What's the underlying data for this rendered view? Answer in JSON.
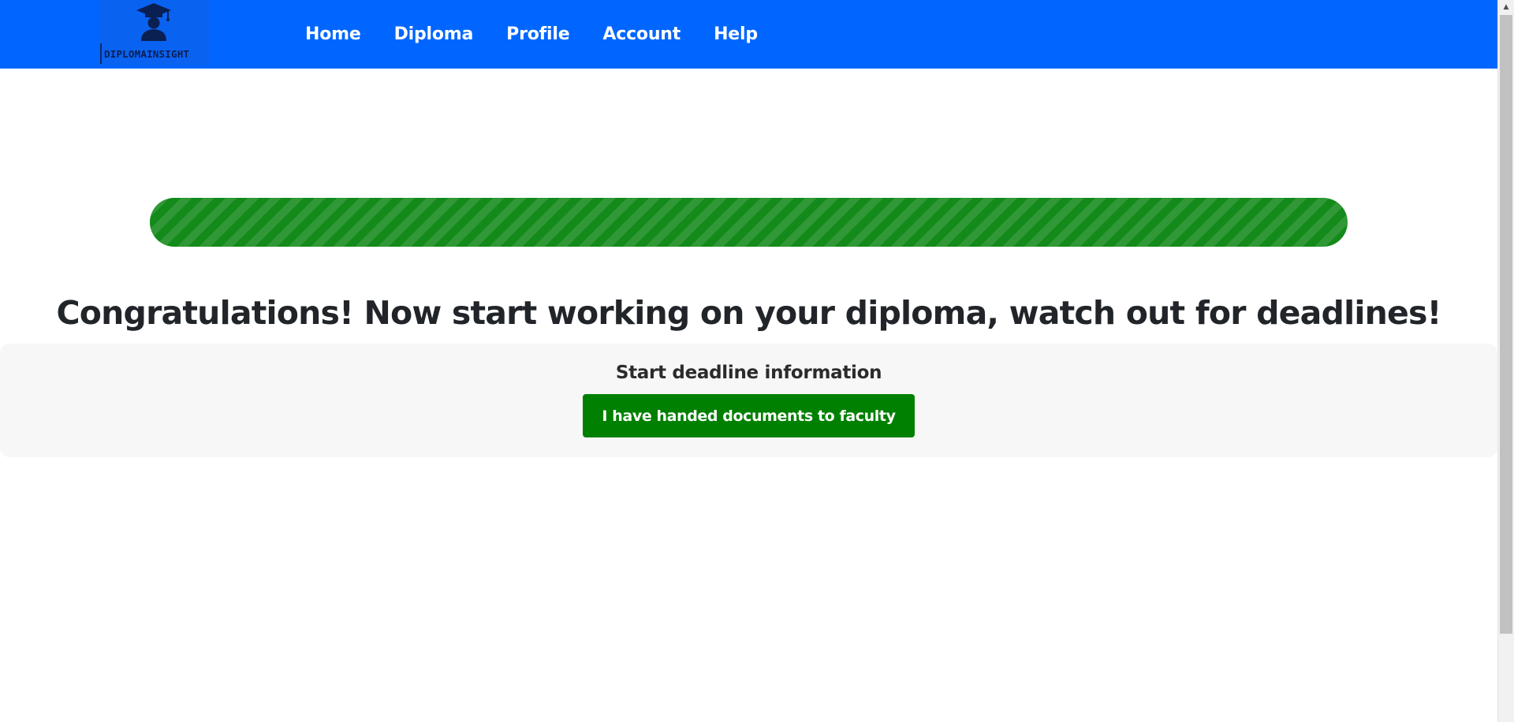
{
  "brand": {
    "logo_text": "DIPLOMAINSIGHT",
    "logo_icon": "graduate-cap-icon",
    "bg_color": "#0066ff"
  },
  "nav": {
    "items": [
      {
        "label": "Home"
      },
      {
        "label": "Diploma"
      },
      {
        "label": "Profile"
      },
      {
        "label": "Account"
      },
      {
        "label": "Help"
      }
    ]
  },
  "progress": {
    "value_percent": 100,
    "color": "#138a1a",
    "style": "striped"
  },
  "main": {
    "headline": "Congratulations! Now start working on your diploma, watch out for deadlines!"
  },
  "deadline_card": {
    "title": "Start deadline information",
    "button_label": "I have handed documents to faculty",
    "button_color": "#008000"
  }
}
